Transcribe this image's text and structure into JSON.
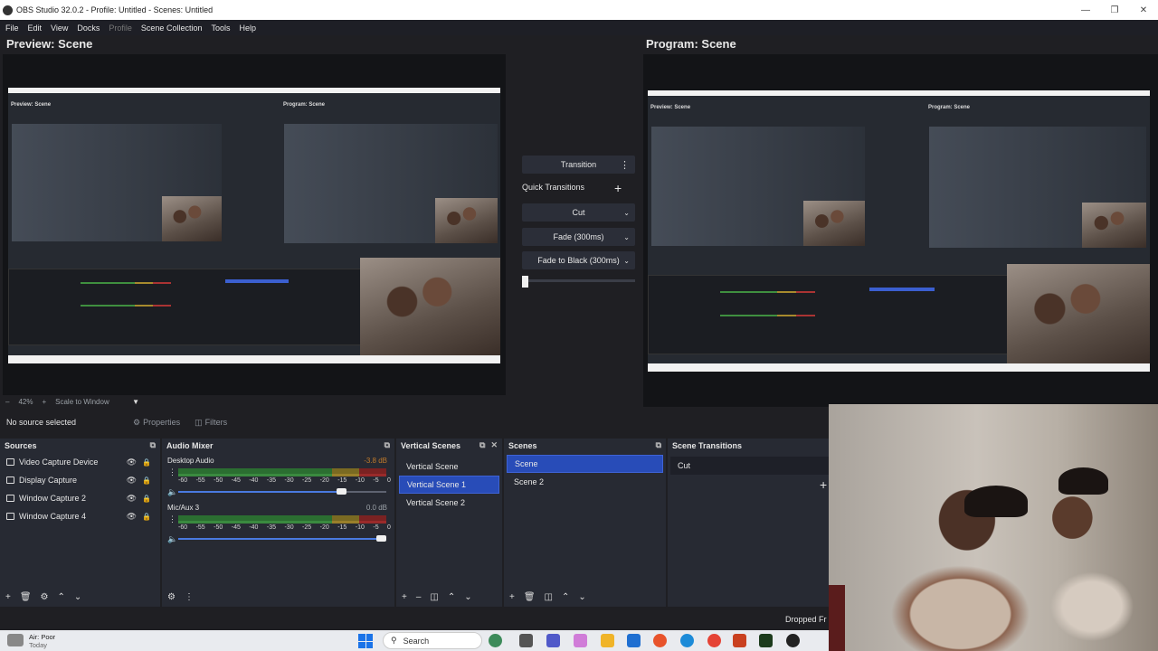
{
  "window": {
    "title": "OBS Studio 32.0.2 - Profile: Untitled - Scenes: Untitled"
  },
  "menu": [
    "File",
    "Edit",
    "View",
    "Docks",
    "Profile",
    "Scene Collection",
    "Tools",
    "Help"
  ],
  "preview": {
    "title": "Preview: Scene",
    "zoom": "42%",
    "scale_mode": "Scale to Window",
    "mini_preview_title": "Preview: Scene",
    "mini_program_title": "Program: Scene"
  },
  "program": {
    "title": "Program: Scene",
    "mini_preview_title": "Preview: Scene",
    "mini_program_title": "Program: Scene"
  },
  "transitions": {
    "transition_label": "Transition",
    "quick_transitions_label": "Quick Transitions",
    "items": [
      "Cut",
      "Fade (300ms)",
      "Fade to Black (300ms)"
    ],
    "progress": 0.0
  },
  "source_toolbar": {
    "no_source": "No source selected",
    "properties": "Properties",
    "filters": "Filters"
  },
  "sources": {
    "title": "Sources",
    "items": [
      "Video Capture Device",
      "Display Capture",
      "Window Capture 2",
      "Window Capture 4"
    ]
  },
  "audio_mixer": {
    "title": "Audio Mixer",
    "scale": [
      "-60",
      "-55",
      "-50",
      "-45",
      "-40",
      "-35",
      "-30",
      "-25",
      "-20",
      "-15",
      "-10",
      "-5",
      "0"
    ],
    "channels": [
      {
        "name": "Desktop Audio",
        "db": "-3.8 dB",
        "volume": 0.81
      },
      {
        "name": "Mic/Aux 3",
        "db": "0.0 dB",
        "volume": 1.0
      }
    ]
  },
  "vertical_scenes": {
    "title": "Vertical Scenes",
    "items": [
      "Vertical Scene",
      "Vertical Scene 1",
      "Vertical Scene 2"
    ],
    "selected": 1
  },
  "scenes": {
    "title": "Scenes",
    "items": [
      "Scene",
      "Scene 2"
    ],
    "selected": 0
  },
  "scene_transitions": {
    "title": "Scene Transitions",
    "current": "Cut"
  },
  "status": {
    "dropped": "Dropped Fr"
  },
  "taskbar": {
    "weather_main": "Air: Poor",
    "weather_sub": "Today",
    "search_placeholder": "Search"
  },
  "colors": {
    "accent": "#284cb8",
    "panel": "#272a33",
    "background": "#1f1f23"
  }
}
